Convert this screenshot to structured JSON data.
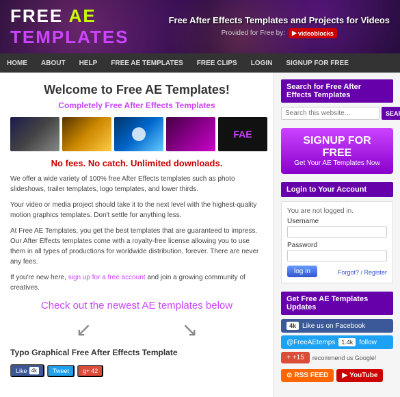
{
  "header": {
    "logo_free": "FREE",
    "logo_ae": "AE",
    "logo_templates": "TEMPLATES",
    "tagline": "Free After Effects Templates and Projects for Videos",
    "provided_prefix": "Provided for Free by:",
    "videoblocks_label": "videoblocks"
  },
  "nav": {
    "items": [
      {
        "label": "HOME",
        "id": "nav-home"
      },
      {
        "label": "ABOUT",
        "id": "nav-about"
      },
      {
        "label": "HELP",
        "id": "nav-help"
      },
      {
        "label": "FREE AE TEMPLATES",
        "id": "nav-free-ae"
      },
      {
        "label": "FREE CLIPS",
        "id": "nav-free-clips"
      },
      {
        "label": "LOGIN",
        "id": "nav-login"
      },
      {
        "label": "SIGNUP FOR FREE",
        "id": "nav-signup"
      }
    ]
  },
  "content": {
    "welcome_title": "Welcome to Free AE Templates!",
    "free_subtitle": "Completely Free After Effects Templates",
    "no_fees": "No fees. No catch. Unlimited downloads.",
    "body_paragraph1": "We offer a wide variety of 100% free After Effects templates such as photo slideshows, trailer templates, logo templates, and lower thirds.",
    "body_paragraph2": "Your video or media project should take it to the next level with the highest-quality motion graphics templates. Don't settle for anything less.",
    "body_paragraph3": "At Free AE Templates, you get the best templates that are guaranteed to impress. Our After Effects templates come with a royalty-free license allowing you to use them in all types of productions for worldwide distribution, forever. There are never any fees.",
    "body_paragraph4": "If you're new here, sign up for a free account and join a growing community of creatives.",
    "check_newest_prefix": "Check out the newest",
    "check_newest_link": "AE templates",
    "check_newest_suffix": "below",
    "section_title": "Typo Graphical Free After Effects Template",
    "social": {
      "fb_like": "Like",
      "fb_count": "4k",
      "tweet": "Tweet",
      "gplus": "g+",
      "gplus_count": "42"
    }
  },
  "sidebar": {
    "search_section": {
      "title": "Search for Free After Effects Templates",
      "placeholder": "Search this website...",
      "button": "SEARCH"
    },
    "signup_section": {
      "title": "SIGNUP FOR FREE",
      "subtitle": "Get Your AE Templates Now"
    },
    "login_section": {
      "title": "Login to Your Account",
      "not_logged": "You are not logged in.",
      "username_label": "Username",
      "password_label": "Password",
      "login_button": "log in",
      "forgot_link": "Forgot?",
      "register_link": "Register"
    },
    "updates_section": {
      "title": "Get Free AE Templates Updates",
      "fb_count": "4k",
      "fb_like_text": "Like us on Facebook",
      "tw_handle": "@FreeAEtemps",
      "tw_count": "1.4k",
      "tw_follow": "follow",
      "gp_count": "+1",
      "gp_sub_count": "+15",
      "gp_recommend": "recommend us Google!",
      "rss_label": "RSS FEED",
      "yt_label": "YouTube"
    }
  }
}
